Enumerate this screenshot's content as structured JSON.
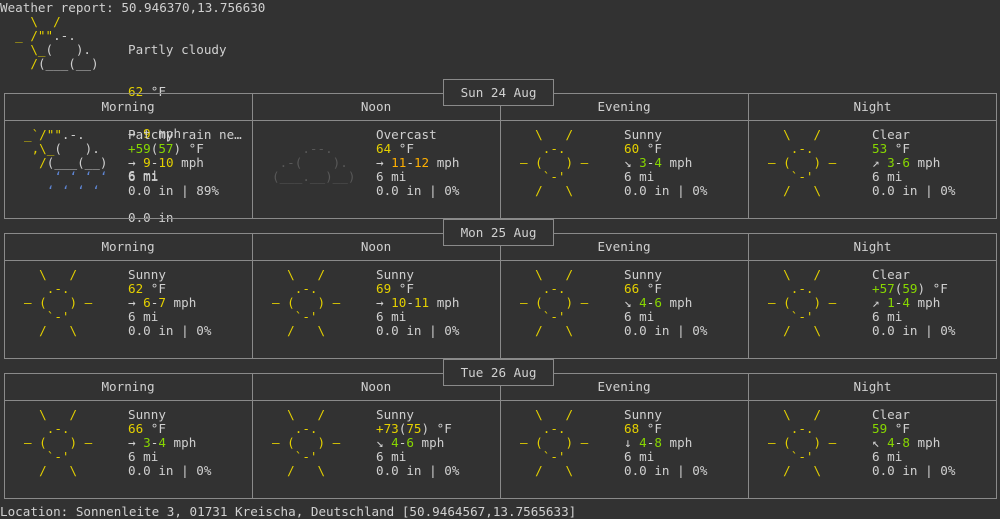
{
  "header_text": "Weather report: 50.946370,13.756630",
  "current": {
    "art_icon": "partly-cloudy-icon",
    "art_lines": [
      [
        {
          "t": "    ",
          "c": ""
        },
        {
          "t": "\\  /",
          "c": "#e4d000"
        }
      ],
      [
        {
          "t": "  ",
          "c": ""
        },
        {
          "t": "_ /\"\"",
          "c": "#e4d000"
        },
        {
          "t": ".-.",
          "c": "#d0d0d0"
        }
      ],
      [
        {
          "t": "    ",
          "c": ""
        },
        {
          "t": "\\_",
          "c": "#e4d000"
        },
        {
          "t": "(   ).",
          "c": "#d0d0d0"
        }
      ],
      [
        {
          "t": "    ",
          "c": ""
        },
        {
          "t": "/",
          "c": "#e4d000"
        },
        {
          "t": "(___(__)",
          "c": "#d0d0d0"
        }
      ]
    ],
    "condition": "Partly cloudy",
    "temp": "62",
    "temp_unit": " °F",
    "wind_arrow": "→ ",
    "wind": "9",
    "wind_unit": " mph",
    "visibility": "6 mi",
    "precip": "0.0 in"
  },
  "days": [
    {
      "date": "Sun 24 Aug",
      "periods": [
        {
          "name": "Morning",
          "icon": "patchy-rain-icon",
          "condition": "Patchy rain ne…",
          "temp_line": [
            {
              "t": "+59",
              "c": "#87d700"
            },
            {
              "t": "(",
              "c": ""
            },
            {
              "t": "57",
              "c": "#87d700"
            },
            {
              "t": ") °F",
              "c": ""
            }
          ],
          "wind_line": [
            {
              "t": "→ ",
              "c": ""
            },
            {
              "t": "9",
              "c": "#e4d000"
            },
            {
              "t": "-",
              "c": ""
            },
            {
              "t": "10",
              "c": "#e4d000"
            },
            {
              "t": " mph",
              "c": ""
            }
          ],
          "visibility": "6 mi",
          "precip": "0.0 in | 89%"
        },
        {
          "name": "Noon",
          "icon": "overcast-icon",
          "condition": "Overcast",
          "temp_line": [
            {
              "t": "64",
              "c": "#e4d000"
            },
            {
              "t": " °F",
              "c": ""
            }
          ],
          "wind_line": [
            {
              "t": "→ ",
              "c": ""
            },
            {
              "t": "11",
              "c": "#ffaf00"
            },
            {
              "t": "-",
              "c": ""
            },
            {
              "t": "12",
              "c": "#ffaf00"
            },
            {
              "t": " mph",
              "c": ""
            }
          ],
          "visibility": "6 mi",
          "precip": "0.0 in | 0%"
        },
        {
          "name": "Evening",
          "icon": "sunny-icon",
          "condition": "Sunny",
          "temp_line": [
            {
              "t": "60",
              "c": "#e4d000"
            },
            {
              "t": " °F",
              "c": ""
            }
          ],
          "wind_line": [
            {
              "t": "↘ ",
              "c": ""
            },
            {
              "t": "3",
              "c": "#87d700"
            },
            {
              "t": "-",
              "c": ""
            },
            {
              "t": "4",
              "c": "#87d700"
            },
            {
              "t": " mph",
              "c": ""
            }
          ],
          "visibility": "6 mi",
          "precip": "0.0 in | 0%"
        },
        {
          "name": "Night",
          "icon": "clear-night-icon",
          "condition": "Clear",
          "temp_line": [
            {
              "t": "53",
              "c": "#87d700"
            },
            {
              "t": " °F",
              "c": ""
            }
          ],
          "wind_line": [
            {
              "t": "↗ ",
              "c": ""
            },
            {
              "t": "3",
              "c": "#87d700"
            },
            {
              "t": "-",
              "c": ""
            },
            {
              "t": "6",
              "c": "#87d700"
            },
            {
              "t": " mph",
              "c": ""
            }
          ],
          "visibility": "6 mi",
          "precip": "0.0 in | 0%"
        }
      ]
    },
    {
      "date": "Mon 25 Aug",
      "periods": [
        {
          "name": "Morning",
          "icon": "sunny-icon",
          "condition": "Sunny",
          "temp_line": [
            {
              "t": "62",
              "c": "#e4d000"
            },
            {
              "t": " °F",
              "c": ""
            }
          ],
          "wind_line": [
            {
              "t": "→ ",
              "c": ""
            },
            {
              "t": "6",
              "c": "#e4d000"
            },
            {
              "t": "-",
              "c": ""
            },
            {
              "t": "7",
              "c": "#e4d000"
            },
            {
              "t": " mph",
              "c": ""
            }
          ],
          "visibility": "6 mi",
          "precip": "0.0 in | 0%"
        },
        {
          "name": "Noon",
          "icon": "sunny-icon",
          "condition": "Sunny",
          "temp_line": [
            {
              "t": "69",
              "c": "#e4d000"
            },
            {
              "t": " °F",
              "c": ""
            }
          ],
          "wind_line": [
            {
              "t": "→ ",
              "c": ""
            },
            {
              "t": "10",
              "c": "#e4d000"
            },
            {
              "t": "-",
              "c": ""
            },
            {
              "t": "11",
              "c": "#e4d000"
            },
            {
              "t": " mph",
              "c": ""
            }
          ],
          "visibility": "6 mi",
          "precip": "0.0 in | 0%"
        },
        {
          "name": "Evening",
          "icon": "sunny-icon",
          "condition": "Sunny",
          "temp_line": [
            {
              "t": "66",
              "c": "#e4d000"
            },
            {
              "t": " °F",
              "c": ""
            }
          ],
          "wind_line": [
            {
              "t": "↘ ",
              "c": ""
            },
            {
              "t": "4",
              "c": "#87d700"
            },
            {
              "t": "-",
              "c": ""
            },
            {
              "t": "6",
              "c": "#87d700"
            },
            {
              "t": " mph",
              "c": ""
            }
          ],
          "visibility": "6 mi",
          "precip": "0.0 in | 0%"
        },
        {
          "name": "Night",
          "icon": "clear-night-icon",
          "condition": "Clear",
          "temp_line": [
            {
              "t": "+57",
              "c": "#87d700"
            },
            {
              "t": "(",
              "c": ""
            },
            {
              "t": "59",
              "c": "#87d700"
            },
            {
              "t": ") °F",
              "c": ""
            }
          ],
          "wind_line": [
            {
              "t": "↗ ",
              "c": ""
            },
            {
              "t": "1",
              "c": "#87d700"
            },
            {
              "t": "-",
              "c": ""
            },
            {
              "t": "4",
              "c": "#87d700"
            },
            {
              "t": " mph",
              "c": ""
            }
          ],
          "visibility": "6 mi",
          "precip": "0.0 in | 0%"
        }
      ]
    },
    {
      "date": "Tue 26 Aug",
      "periods": [
        {
          "name": "Morning",
          "icon": "sunny-icon",
          "condition": "Sunny",
          "temp_line": [
            {
              "t": "66",
              "c": "#e4d000"
            },
            {
              "t": " °F",
              "c": ""
            }
          ],
          "wind_line": [
            {
              "t": "→ ",
              "c": ""
            },
            {
              "t": "3",
              "c": "#87d700"
            },
            {
              "t": "-",
              "c": ""
            },
            {
              "t": "4",
              "c": "#87d700"
            },
            {
              "t": " mph",
              "c": ""
            }
          ],
          "visibility": "6 mi",
          "precip": "0.0 in | 0%"
        },
        {
          "name": "Noon",
          "icon": "sunny-icon",
          "condition": "Sunny",
          "temp_line": [
            {
              "t": "+73",
              "c": "#e4d000"
            },
            {
              "t": "(",
              "c": ""
            },
            {
              "t": "75",
              "c": "#e4d000"
            },
            {
              "t": ") °F",
              "c": ""
            }
          ],
          "wind_line": [
            {
              "t": "↘ ",
              "c": ""
            },
            {
              "t": "4",
              "c": "#87d700"
            },
            {
              "t": "-",
              "c": ""
            },
            {
              "t": "6",
              "c": "#87d700"
            },
            {
              "t": " mph",
              "c": ""
            }
          ],
          "visibility": "6 mi",
          "precip": "0.0 in | 0%"
        },
        {
          "name": "Evening",
          "icon": "sunny-icon",
          "condition": "Sunny",
          "temp_line": [
            {
              "t": "68",
              "c": "#e4d000"
            },
            {
              "t": " °F",
              "c": ""
            }
          ],
          "wind_line": [
            {
              "t": "↓ ",
              "c": ""
            },
            {
              "t": "4",
              "c": "#87d700"
            },
            {
              "t": "-",
              "c": ""
            },
            {
              "t": "8",
              "c": "#87d700"
            },
            {
              "t": " mph",
              "c": ""
            }
          ],
          "visibility": "6 mi",
          "precip": "0.0 in | 0%"
        },
        {
          "name": "Night",
          "icon": "clear-night-icon",
          "condition": "Clear",
          "temp_line": [
            {
              "t": "59",
              "c": "#87d700"
            },
            {
              "t": " °F",
              "c": ""
            }
          ],
          "wind_line": [
            {
              "t": "↖ ",
              "c": ""
            },
            {
              "t": "4",
              "c": "#87d700"
            },
            {
              "t": "-",
              "c": ""
            },
            {
              "t": "8",
              "c": "#87d700"
            },
            {
              "t": " mph",
              "c": ""
            }
          ],
          "visibility": "6 mi",
          "precip": "0.0 in | 0%"
        }
      ]
    }
  ],
  "icon_art": {
    "sunny-icon": [
      [
        {
          "t": "  \\   /  ",
          "c": "#e4d000"
        }
      ],
      [
        {
          "t": "   .-.   ",
          "c": "#e4d000"
        }
      ],
      [
        {
          "t": "― (   ) ―",
          "c": "#e4d000"
        }
      ],
      [
        {
          "t": "   `-'   ",
          "c": "#e4d000"
        }
      ],
      [
        {
          "t": "  /   \\  ",
          "c": "#e4d000"
        }
      ]
    ],
    "clear-night-icon": [
      [
        {
          "t": "  \\   /  ",
          "c": "#e4d000"
        }
      ],
      [
        {
          "t": "   .-.   ",
          "c": "#e4d000"
        }
      ],
      [
        {
          "t": "― (   ) ―",
          "c": "#e4d000"
        }
      ],
      [
        {
          "t": "   `-'   ",
          "c": "#e4d000"
        }
      ],
      [
        {
          "t": "  /   \\  ",
          "c": "#e4d000"
        }
      ]
    ],
    "overcast-icon": [
      [
        {
          "t": "         ",
          "c": ""
        }
      ],
      [
        {
          "t": "    .--. ",
          "c": "#585858"
        }
      ],
      [
        {
          "t": " .-(    ).",
          "c": "#585858"
        }
      ],
      [
        {
          "t": "(___.__)__)",
          "c": "#585858"
        }
      ],
      [
        {
          "t": "         ",
          "c": ""
        }
      ]
    ],
    "patchy-rain-icon": [
      [
        {
          "t": "_`/\"\"",
          "c": "#e4d000"
        },
        {
          "t": ".-.",
          "c": "#d0d0d0"
        }
      ],
      [
        {
          "t": " ,\\_",
          "c": "#e4d000"
        },
        {
          "t": "(   ).",
          "c": "#d0d0d0"
        }
      ],
      [
        {
          "t": "  /",
          "c": "#e4d000"
        },
        {
          "t": "(___(__)",
          "c": "#d0d0d0"
        }
      ],
      [
        {
          "t": "    ʻ ʻ ʻ ʻ",
          "c": "#5f87d7"
        }
      ],
      [
        {
          "t": "   ʻ ʻ ʻ ʻ",
          "c": "#5f87d7"
        }
      ]
    ]
  },
  "footer_text": "Location: Sonnenleite 3, 01731 Kreischa, Deutschland [50.9464567,13.7565633]"
}
